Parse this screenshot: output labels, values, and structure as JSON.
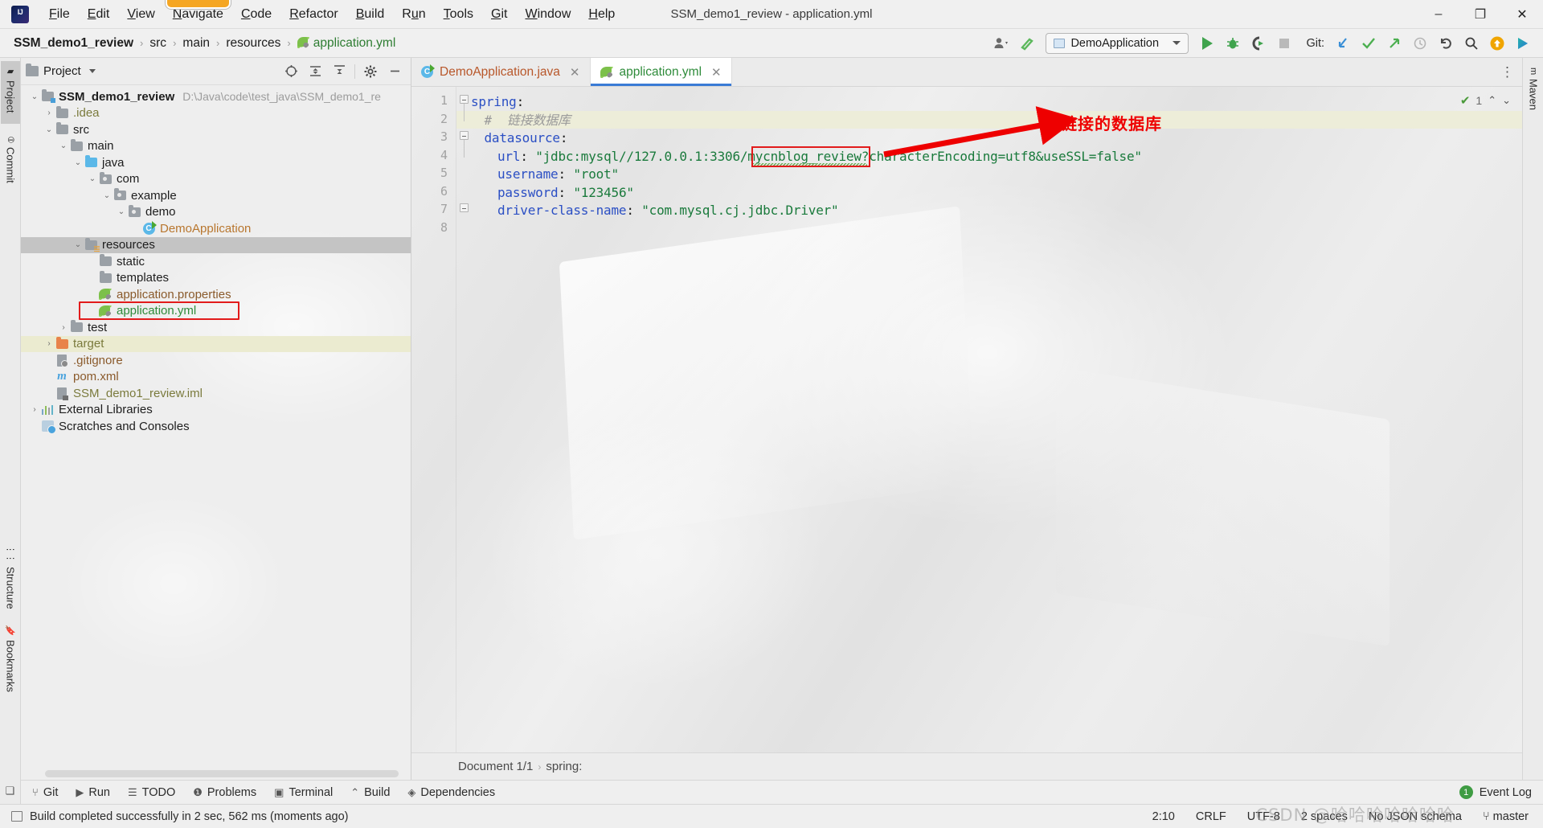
{
  "window": {
    "title": "SSM_demo1_review - application.yml",
    "minimize": "–",
    "maximize": "❐",
    "close": "✕"
  },
  "menu": {
    "items": [
      {
        "label": "File",
        "mnemonic": "F"
      },
      {
        "label": "Edit",
        "mnemonic": "E"
      },
      {
        "label": "View",
        "mnemonic": "V"
      },
      {
        "label": "Navigate",
        "mnemonic": "N"
      },
      {
        "label": "Code",
        "mnemonic": "C"
      },
      {
        "label": "Refactor",
        "mnemonic": "R"
      },
      {
        "label": "Build",
        "mnemonic": "B"
      },
      {
        "label": "Run",
        "mnemonic": "u"
      },
      {
        "label": "Tools",
        "mnemonic": "T"
      },
      {
        "label": "Git",
        "mnemonic": "G"
      },
      {
        "label": "Window",
        "mnemonic": "W"
      },
      {
        "label": "Help",
        "mnemonic": "H"
      }
    ],
    "highlighted": "Navigate"
  },
  "navbar": {
    "breadcrumbs": [
      "SSM_demo1_review",
      "src",
      "main",
      "resources",
      "application.yml"
    ],
    "separator": "›",
    "run_config": "DemoApplication",
    "git_label": "Git:",
    "icons": [
      "user-avatar-icon",
      "hammer-icon",
      "run-icon",
      "debug-icon",
      "run-coverage-icon",
      "stop-icon",
      "git-update-icon",
      "git-commit-icon",
      "git-push-icon",
      "git-history-icon",
      "git-rollback-icon",
      "search-everywhere-icon",
      "update-badge-icon",
      "ide-extras-icon"
    ]
  },
  "left_strip": {
    "tabs": [
      {
        "label": "Project",
        "selected": true
      },
      {
        "label": "Commit",
        "selected": false
      },
      {
        "label": "Structure",
        "selected": false
      },
      {
        "label": "Bookmarks",
        "selected": false
      }
    ]
  },
  "right_strip": {
    "tabs": [
      {
        "label": "Maven",
        "selected": false
      }
    ]
  },
  "project_panel": {
    "title": "Project",
    "tools": [
      "locate-icon",
      "expand-all-icon",
      "collapse-all-icon",
      "settings-gear-icon",
      "hide-icon"
    ],
    "tree": [
      {
        "depth": 0,
        "arrow": "expanded",
        "icon": "module-folder",
        "label": "SSM_demo1_review",
        "bold": true,
        "color": "default",
        "hint": "D:\\Java\\code\\test_java\\SSM_demo1_re"
      },
      {
        "depth": 1,
        "arrow": "collapsed",
        "icon": "folder",
        "label": ".idea",
        "color": "olive"
      },
      {
        "depth": 1,
        "arrow": "expanded",
        "icon": "folder",
        "label": "src",
        "color": "default"
      },
      {
        "depth": 2,
        "arrow": "expanded",
        "icon": "folder",
        "label": "main",
        "color": "default"
      },
      {
        "depth": 3,
        "arrow": "expanded",
        "icon": "folder-blue",
        "label": "java",
        "color": "default"
      },
      {
        "depth": 4,
        "arrow": "expanded",
        "icon": "folder-pkg",
        "label": "com",
        "color": "default"
      },
      {
        "depth": 5,
        "arrow": "expanded",
        "icon": "folder-pkg",
        "label": "example",
        "color": "default"
      },
      {
        "depth": 6,
        "arrow": "expanded",
        "icon": "folder-pkg",
        "label": "demo",
        "color": "default"
      },
      {
        "depth": 7,
        "arrow": "none",
        "icon": "class",
        "label": "DemoApplication",
        "color": "orange"
      },
      {
        "depth": 3,
        "arrow": "expanded",
        "icon": "folder-resources",
        "label": "resources",
        "color": "default",
        "selected": true
      },
      {
        "depth": 4,
        "arrow": "none",
        "icon": "folder",
        "label": "static",
        "color": "default"
      },
      {
        "depth": 4,
        "arrow": "none",
        "icon": "folder",
        "label": "templates",
        "color": "default"
      },
      {
        "depth": 4,
        "arrow": "none",
        "icon": "leaf",
        "label": "application.properties",
        "color": "brown"
      },
      {
        "depth": 4,
        "arrow": "none",
        "icon": "leaf",
        "label": "application.yml",
        "color": "green",
        "highlighted": true
      },
      {
        "depth": 2,
        "arrow": "collapsed",
        "icon": "folder",
        "label": "test",
        "color": "default"
      },
      {
        "depth": 1,
        "arrow": "collapsed",
        "icon": "folder-orange",
        "label": "target",
        "color": "olive",
        "row_highlight": true
      },
      {
        "depth": 1,
        "arrow": "none",
        "icon": "file",
        "label": ".gitignore",
        "color": "brown"
      },
      {
        "depth": 1,
        "arrow": "none",
        "icon": "maven",
        "label": "pom.xml",
        "color": "brown"
      },
      {
        "depth": 1,
        "arrow": "none",
        "icon": "iml",
        "label": "SSM_demo1_review.iml",
        "color": "olive"
      },
      {
        "depth": 0,
        "arrow": "collapsed",
        "icon": "libraries",
        "label": "External Libraries",
        "color": "default"
      },
      {
        "depth": 0,
        "arrow": "none",
        "icon": "scratches",
        "label": "Scratches and Consoles",
        "color": "default"
      }
    ]
  },
  "editor": {
    "tabs": [
      {
        "label": "DemoApplication.java",
        "icon": "java-class-icon",
        "active": false,
        "kind": "java"
      },
      {
        "label": "application.yml",
        "icon": "spring-leaf-icon",
        "active": true,
        "kind": "yml"
      }
    ],
    "line_numbers": [
      "1",
      "2",
      "3",
      "4",
      "5",
      "6",
      "7",
      "8"
    ],
    "code": [
      {
        "n": 1,
        "indent": 0,
        "parts": [
          {
            "t": "spring",
            "c": "k"
          },
          {
            "t": ":",
            "c": "p"
          }
        ]
      },
      {
        "n": 2,
        "indent": 1,
        "comment": "#  链接数据库",
        "highlight": true
      },
      {
        "n": 3,
        "indent": 1,
        "parts": [
          {
            "t": "datasource",
            "c": "k"
          },
          {
            "t": ":",
            "c": "p"
          }
        ]
      },
      {
        "n": 4,
        "indent": 2,
        "parts": [
          {
            "t": "url",
            "c": "k"
          },
          {
            "t": ": ",
            "c": "p"
          },
          {
            "t": "\"jdbc:mysql//127.0.0.1:3306/mycnblog_review?characterEncoding=utf8&useSSL=false\"",
            "c": "s"
          }
        ]
      },
      {
        "n": 5,
        "indent": 2,
        "parts": [
          {
            "t": "username",
            "c": "k"
          },
          {
            "t": ": ",
            "c": "p"
          },
          {
            "t": "\"root\"",
            "c": "s"
          }
        ]
      },
      {
        "n": 6,
        "indent": 2,
        "parts": [
          {
            "t": "password",
            "c": "k"
          },
          {
            "t": ": ",
            "c": "p"
          },
          {
            "t": "\"123456\"",
            "c": "s"
          }
        ]
      },
      {
        "n": 7,
        "indent": 2,
        "parts": [
          {
            "t": "driver-class-name",
            "c": "k"
          },
          {
            "t": ": ",
            "c": "p"
          },
          {
            "t": "\"com.mysql.cj.jdbc.Driver\"",
            "c": "s"
          }
        ]
      },
      {
        "n": 8,
        "indent": 0,
        "parts": []
      }
    ],
    "inspection": {
      "count": "1",
      "check_icon": "inspection-ok-icon",
      "up": "⌃",
      "down": "⌄"
    },
    "breadcrumb": [
      "Document 1/1",
      "spring:"
    ],
    "breadcrumb_sep": "›"
  },
  "annotation": {
    "text": "链接的数据库",
    "color": "#ee0000",
    "highlighted_token": "mycnblog_review"
  },
  "toolwindow_bar": {
    "items": [
      {
        "label": "Git",
        "icon": "git-branch-icon"
      },
      {
        "label": "Run",
        "icon": "run-play-icon"
      },
      {
        "label": "TODO",
        "icon": "todo-list-icon"
      },
      {
        "label": "Problems",
        "icon": "problems-icon"
      },
      {
        "label": "Terminal",
        "icon": "terminal-icon"
      },
      {
        "label": "Build",
        "icon": "build-hammer-icon"
      },
      {
        "label": "Dependencies",
        "icon": "dependencies-icon"
      }
    ],
    "event_log": {
      "label": "Event Log",
      "badge": "1"
    }
  },
  "statusbar": {
    "message": "Build completed successfully in 2 sec, 562 ms (moments ago)",
    "right": [
      {
        "label": "2:10",
        "name": "caret-position"
      },
      {
        "label": "CRLF",
        "name": "line-separator"
      },
      {
        "label": "UTF-8",
        "name": "file-encoding"
      },
      {
        "label": "2 spaces",
        "name": "indent-setting"
      },
      {
        "label": "No JSON schema",
        "name": "json-schema"
      },
      {
        "label": "master",
        "name": "git-branch"
      }
    ]
  },
  "watermark": "CSDN @哈哈哈哈哈哈哈"
}
